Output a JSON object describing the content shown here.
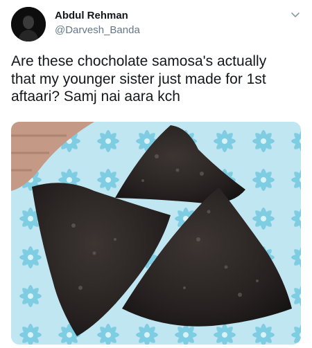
{
  "author": {
    "name": "Abdul Rehman",
    "handle": "@Darvesh_Banda",
    "avatar_icon": "avatar-photo"
  },
  "tweet": {
    "text": "Are these chocholate samosa's actually\nthat my younger sister just made for 1st\naftaari? Samj nai aara kch"
  },
  "menu": {
    "icon": "chevron-down-icon"
  },
  "colors": {
    "text": "#14171a",
    "secondary": "#657786",
    "placemat": "#8fd3e6",
    "samosa": "#2b2624"
  },
  "media": {
    "description_icon": "photo-of-dark-fried-samosas"
  }
}
